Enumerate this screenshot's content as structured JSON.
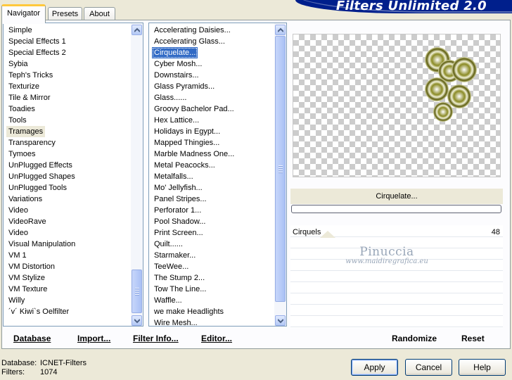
{
  "header": {
    "title": "Filters Unlimited 2.0"
  },
  "tabs": [
    {
      "label": "Navigator",
      "active": true
    },
    {
      "label": "Presets",
      "active": false
    },
    {
      "label": "About",
      "active": false
    }
  ],
  "category_list": {
    "items": [
      "Simple",
      "Special Effects 1",
      "Special Effects 2",
      "Sybia",
      "Teph's Tricks",
      "Texturize",
      "Tile & Mirror",
      "Toadies",
      "Tools",
      "Tramages",
      "Transparency",
      "Tymoes",
      "UnPlugged Effects",
      "UnPlugged Shapes",
      "UnPlugged Tools",
      "Variations",
      "Video",
      "VideoRave",
      "Video",
      "Visual Manipulation",
      "VM 1",
      "VM Distortion",
      "VM Stylize",
      "VM Texture",
      "Willy",
      "´v´ Kiwi`s Oelfilter"
    ],
    "selected": "Tramages"
  },
  "filter_list": {
    "items": [
      "Accelerating Daisies...",
      "Accelerating Glass...",
      "Cirquelate...",
      "Cyber Mosh...",
      "Downstairs...",
      "Glass Pyramids...",
      "Glass......",
      "Groovy Bachelor Pad...",
      "Hex Lattice...",
      "Holidays in Egypt...",
      "Mapped Thingies...",
      "Marble Madness One...",
      "Metal Peacocks...",
      "Metalfalls...",
      "Mo' Jellyfish...",
      "Panel Stripes...",
      "Perforator 1...",
      "Pool Shadow...",
      "Print Screen...",
      "Quilt......",
      "Starmaker...",
      "TeeWee...",
      "The Stump 2...",
      "Tow The Line...",
      "Waffle...",
      "we make Headlights",
      "Wire Mesh..."
    ],
    "selected": "Cirquelate..."
  },
  "preview": {
    "filter_name": "Cirquelate...",
    "progress": 0
  },
  "parameters": [
    {
      "label": "Cirquels",
      "value": "48"
    }
  ],
  "watermark": {
    "name": "Pinuccia",
    "url": "www.maidiregrafica.eu"
  },
  "buttons": {
    "database": "Database",
    "import": "Import...",
    "filter_info": "Filter Info...",
    "editor": "Editor...",
    "randomize": "Randomize",
    "reset": "Reset",
    "apply": "Apply",
    "cancel": "Cancel",
    "help": "Help"
  },
  "status": {
    "database_label": "Database:",
    "database_value": "ICNET-Filters",
    "filters_label": "Filters:",
    "filters_value": "1074"
  },
  "colors": {
    "banner": "#001f8c",
    "selection": "#316ac5",
    "thumbnail_ink": "#7a7a16"
  }
}
